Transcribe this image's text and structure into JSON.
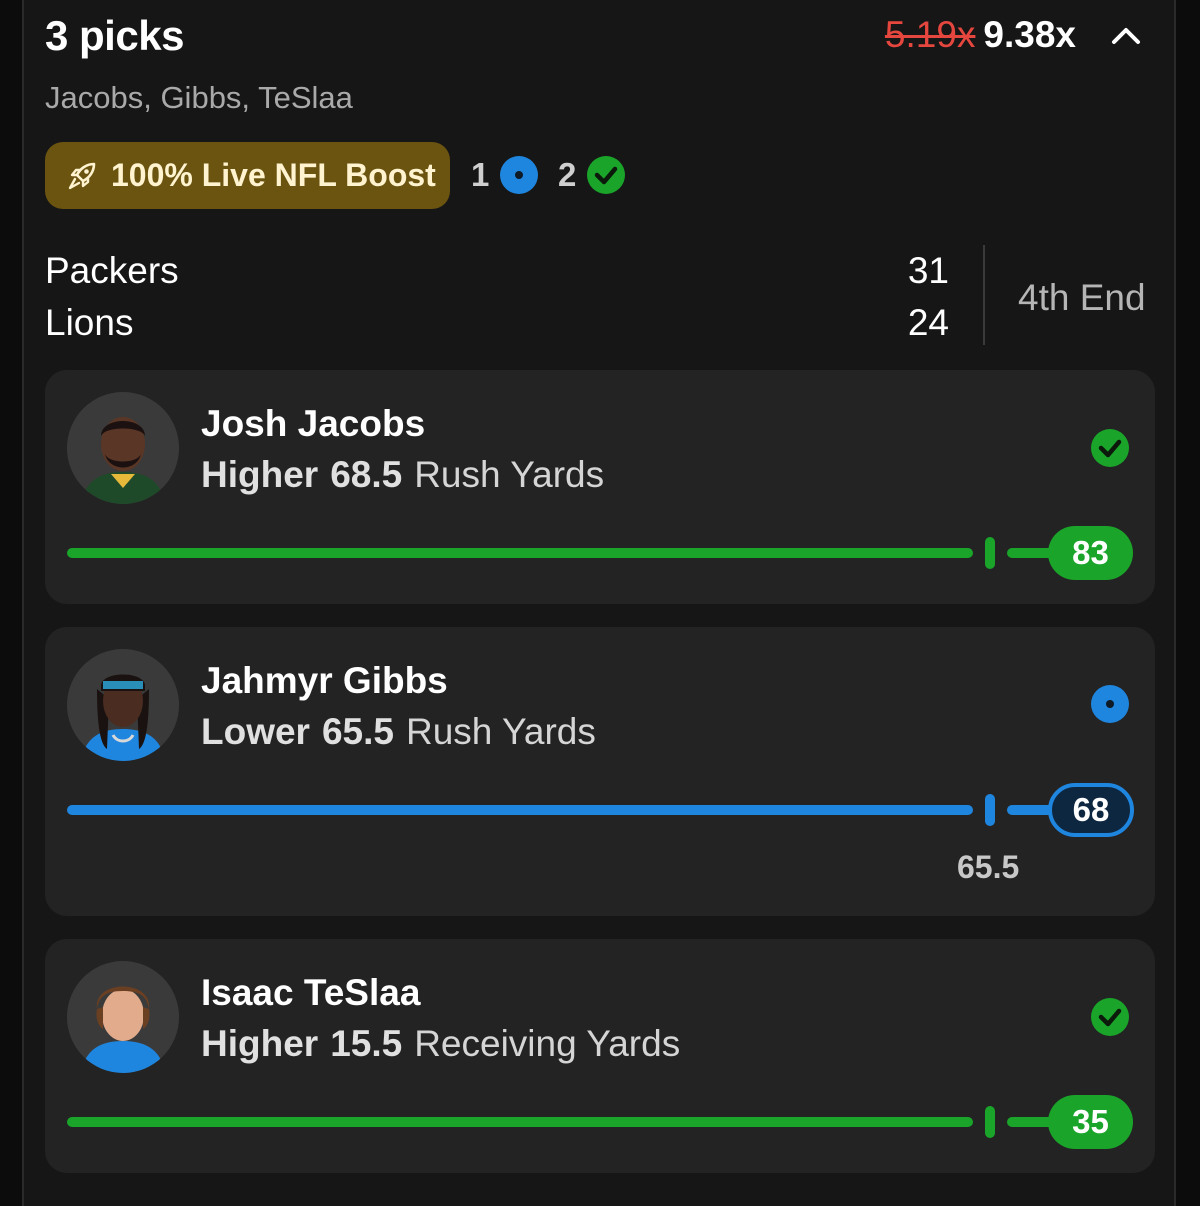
{
  "header": {
    "title": "3 picks",
    "subtitle": "Jacobs, Gibbs, TeSlaa",
    "old_multiplier": "5.19x",
    "new_multiplier": "9.38x"
  },
  "boost": {
    "label": "100% Live NFL Boost",
    "live_count": "1",
    "won_count": "2"
  },
  "game": {
    "teams": [
      {
        "name": "Packers",
        "score": "31"
      },
      {
        "name": "Lions",
        "score": "24"
      }
    ],
    "status": "4th End"
  },
  "colors": {
    "green": "#1aa52a",
    "blue": "#1f86e0",
    "boost_bg": "#6b5410"
  },
  "picks": [
    {
      "player": "Josh Jacobs",
      "direction": "Higher",
      "line": "68.5",
      "stat": "Rush Yards",
      "current": "83",
      "status": "won",
      "status_icon": "check-circle-icon",
      "progress": 0.94
    },
    {
      "player": "Jahmyr Gibbs",
      "direction": "Lower",
      "line": "65.5",
      "stat": "Rush Yards",
      "current": "68",
      "status": "live",
      "status_icon": "live-dot-icon",
      "line_label": "65.5",
      "progress": 0.94
    },
    {
      "player": "Isaac TeSlaa",
      "direction": "Higher",
      "line": "15.5",
      "stat": "Receiving Yards",
      "current": "35",
      "status": "won",
      "status_icon": "check-circle-icon",
      "progress": 0.94
    }
  ]
}
